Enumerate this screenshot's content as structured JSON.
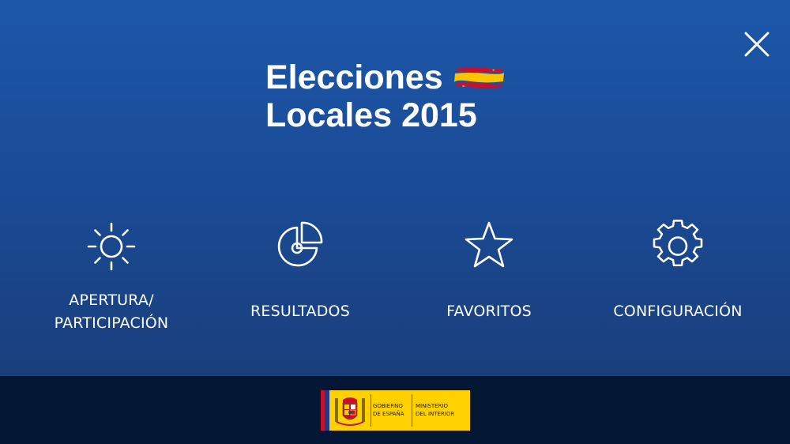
{
  "header": {
    "title_line1": "Elecciones",
    "title_line2": "Locales 2015",
    "close_icon": "close-icon",
    "flag_icon": "spain-flag-icon"
  },
  "menu": [
    {
      "label_line1": "APERTURA/",
      "label_line2": "PARTICIPACIÓN",
      "icon": "sun-icon"
    },
    {
      "label": "RESULTADOS",
      "icon": "pie-chart-icon"
    },
    {
      "label": "FAVORITOS",
      "icon": "star-icon"
    },
    {
      "label": "CONFIGURACIÓN",
      "icon": "gear-icon"
    }
  ],
  "footer": {
    "gov_line1": "GOBIERNO",
    "gov_line2": "DE ESPAÑA",
    "ministry_line1": "MINISTERIO",
    "ministry_line2": "DEL INTERIOR"
  },
  "colors": {
    "background_top": "#1c57aa",
    "background_bottom": "#193a73",
    "footer": "#031634",
    "logo_yellow": "#ffd100",
    "flag_red": "#c8102e",
    "flag_yellow": "#ffc400",
    "text": "#ffffff"
  }
}
